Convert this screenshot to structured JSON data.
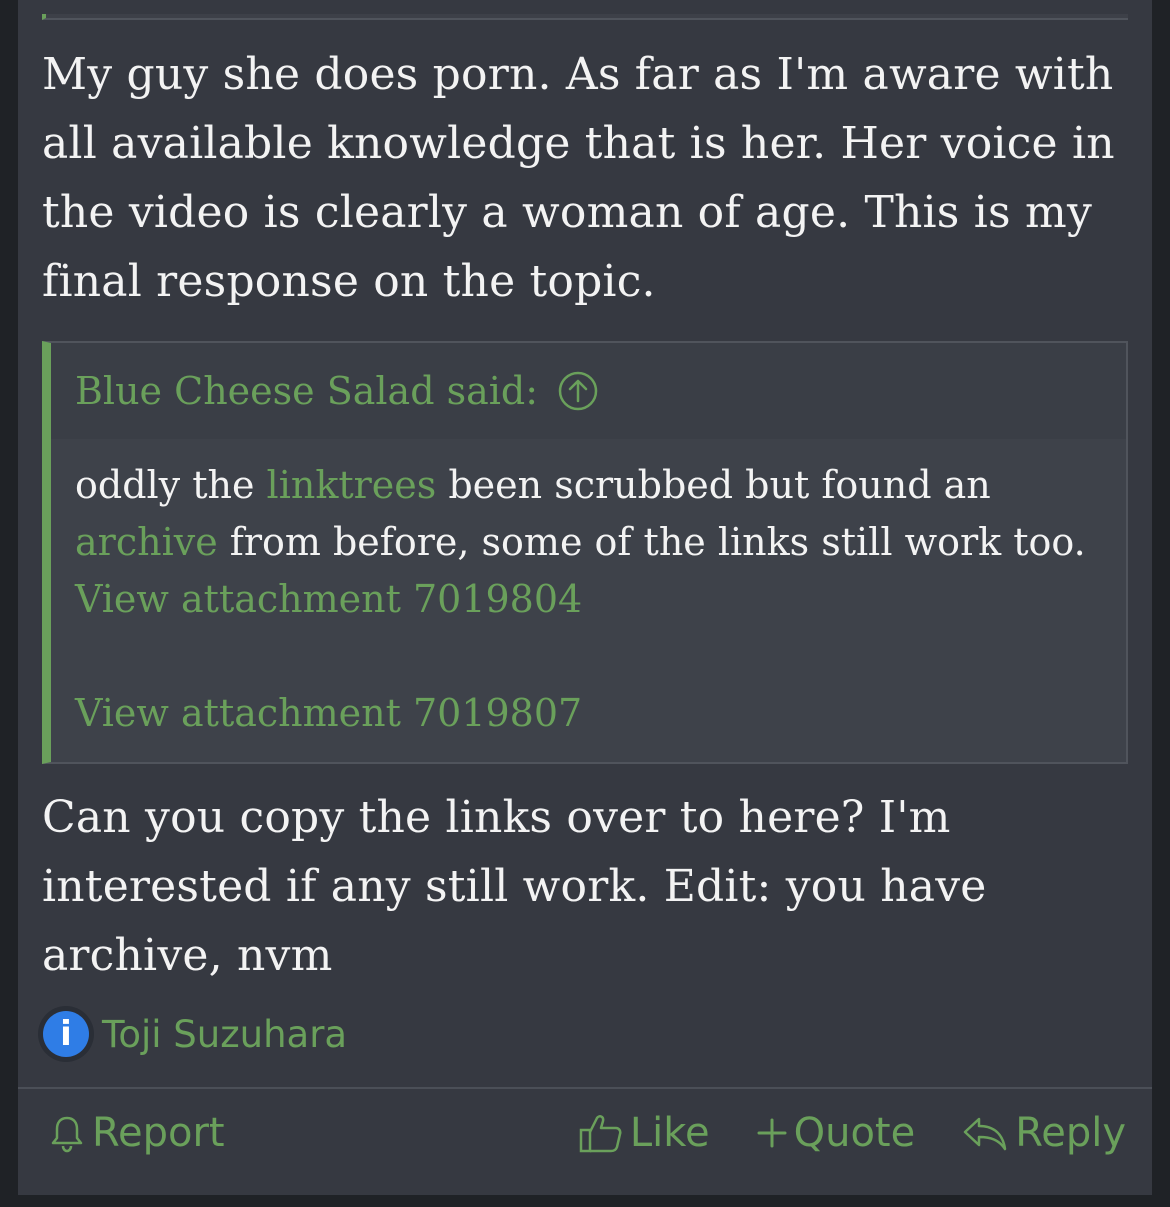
{
  "post": {
    "message_1": "My guy she does porn. As far as I'm aware with all available knowledge that is her. Her voice in the video is clearly a woman of age. This is my final response on the topic.",
    "quote": {
      "author_said": "Blue Cheese Salad said:",
      "text_1": "oddly the ",
      "link_1": "linktrees",
      "text_2": " been scrubbed but found an ",
      "link_2": "archive",
      "text_3": " from before, some of the links still work too.",
      "attachment_1": "View attachment 7019804",
      "attachment_2": "View attachment 7019807"
    },
    "message_2": "Can you copy the links over to here? I'm interested if any still work. Edit: you have archive, nvm",
    "reaction_user": "Toji Suzuhara"
  },
  "actions": {
    "report": "Report",
    "like": "Like",
    "quote": "Quote",
    "reply": "Reply"
  },
  "colors": {
    "accent": "#6aa05b",
    "post_bg": "#363941",
    "quote_bg": "#3e424a",
    "page_bg": "#1f2226",
    "text": "#f3f3f3",
    "info_badge": "#2f7de6"
  },
  "icons": {
    "quote_jump": "arrow-up-circle-icon",
    "reaction": "info-icon",
    "report": "bell-icon",
    "like": "thumbs-up-icon",
    "quote": "plus-icon",
    "reply": "reply-arrow-icon"
  }
}
